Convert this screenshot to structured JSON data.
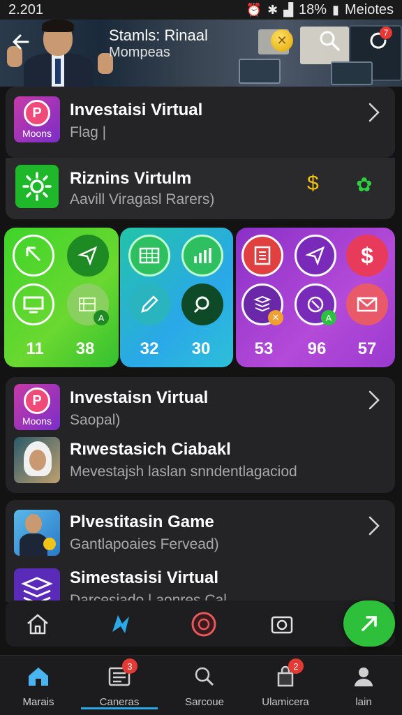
{
  "status_bar": {
    "time": "2.201",
    "battery": "18%",
    "carrier": "Meiotes",
    "icons": [
      "alarm-icon",
      "vibrate-icon",
      "signal-icon",
      "battery-icon"
    ]
  },
  "header": {
    "title": "Stamls: Rinaal",
    "subtitle": "Mompeas",
    "notification_count": "7"
  },
  "card1": {
    "title": "Investaisi Virtual",
    "subtitle": "Flag |",
    "icon_label": "Moons"
  },
  "card2": {
    "title": "Riznins Virtulm",
    "subtitle": "Aavill Viragasl Rarers)"
  },
  "tiles": {
    "green": {
      "numbers": [
        "11",
        "38"
      ]
    },
    "blue": {
      "numbers": [
        "32",
        "30"
      ]
    },
    "purple": {
      "numbers": [
        "53",
        "96",
        "57"
      ]
    }
  },
  "card3": {
    "row1": {
      "title": "Investaisn Virtual",
      "subtitle": "Saopal)",
      "icon_label": "Moons"
    },
    "row2": {
      "title": "Rıwestasich Ciabakl",
      "subtitle": "Mevestajsh laslan snndentlagaciod"
    }
  },
  "card4": {
    "row1": {
      "title": "Plvestitasin Game",
      "subtitle": "Gantlapoaies Fervead)"
    },
    "row2": {
      "title": "Simestasisi Virtual",
      "subtitle": "Darcesiado | aonres Cal"
    }
  },
  "bottom_nav": [
    {
      "label": "Marais",
      "badge": ""
    },
    {
      "label": "Caneras",
      "badge": "3"
    },
    {
      "label": "Sarcoue",
      "badge": ""
    },
    {
      "label": "Ulamicera",
      "badge": "2"
    },
    {
      "label": "lain",
      "badge": ""
    }
  ],
  "colors": {
    "accent_green": "#2ec03a",
    "accent_blue": "#2aa8e8",
    "badge_red": "#e53935",
    "purple": "#9a3ad0"
  }
}
